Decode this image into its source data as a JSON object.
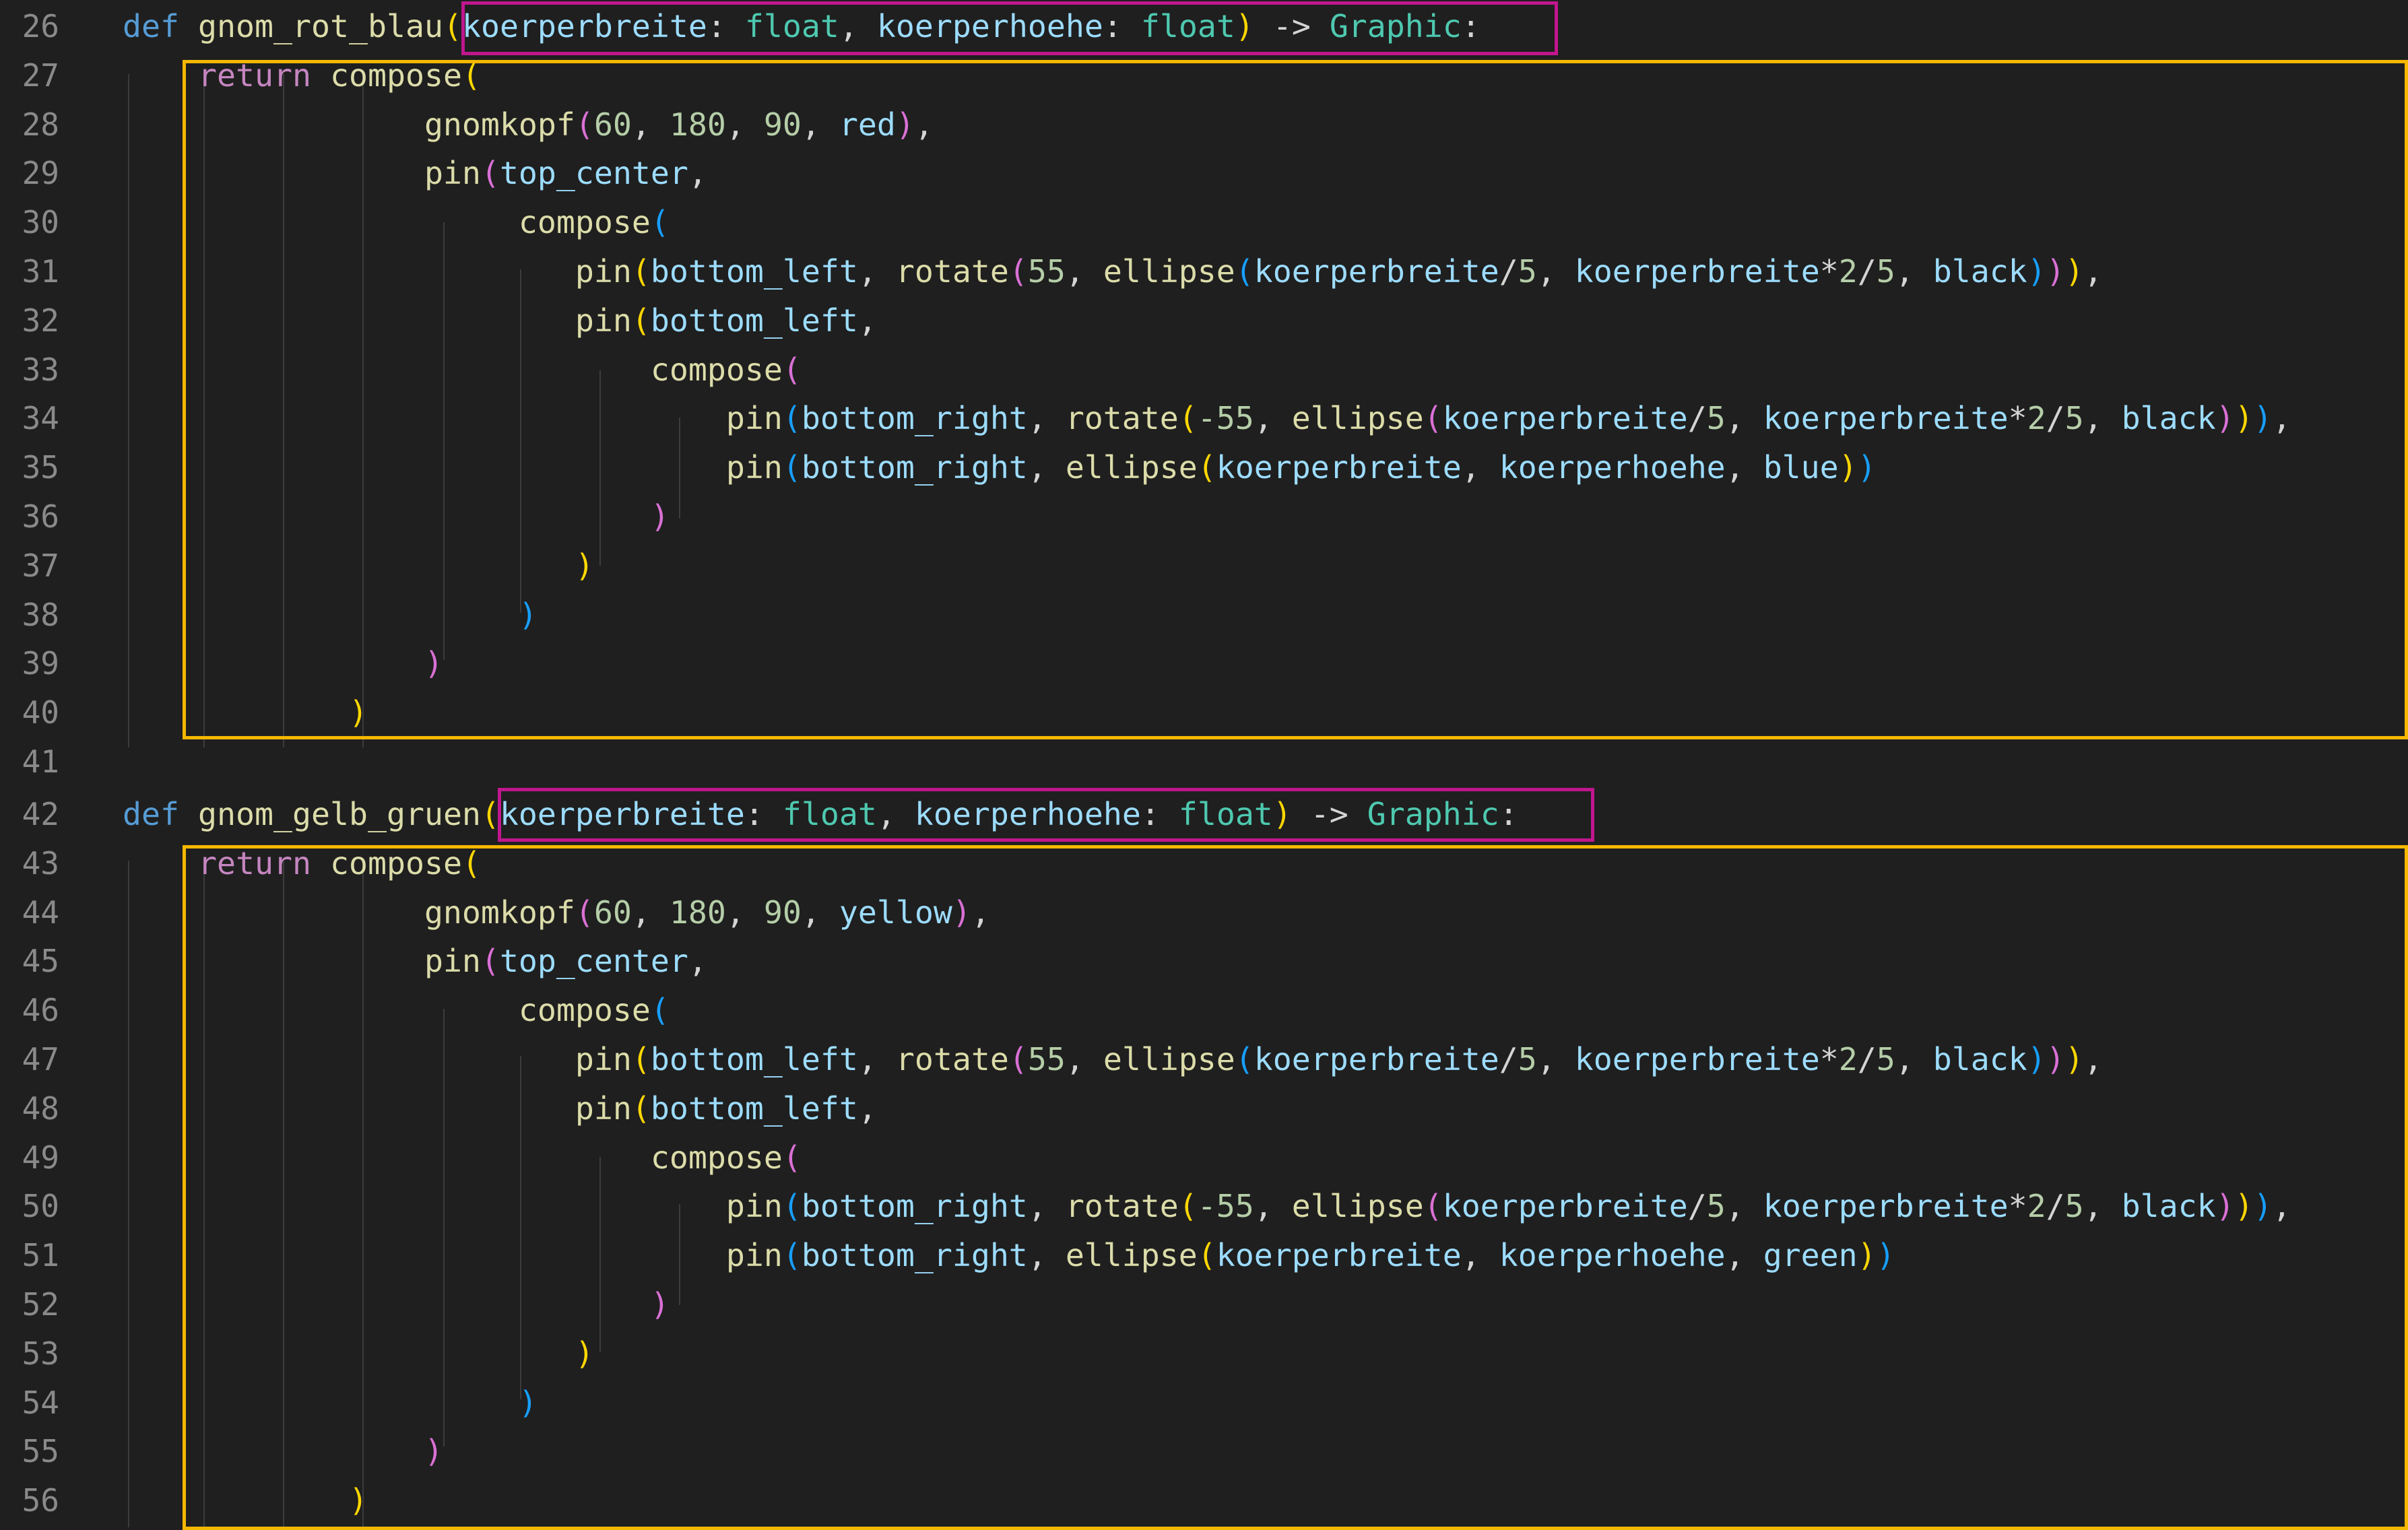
{
  "colors": {
    "background": "#1f1f1f",
    "signature_box": "#c0168e",
    "body_box": "#f5b800"
  },
  "lines": [
    {
      "num": "26",
      "tokens": [
        {
          "t": "def",
          "c": "kw"
        },
        {
          "t": " ",
          "c": "op"
        },
        {
          "t": "gnom_rot_blau",
          "c": "fn"
        },
        {
          "t": "(",
          "c": "b1"
        },
        {
          "t": "koerperbreite",
          "c": "param"
        },
        {
          "t": ": ",
          "c": "op"
        },
        {
          "t": "float",
          "c": "type"
        },
        {
          "t": ", ",
          "c": "op"
        },
        {
          "t": "koerperhoehe",
          "c": "param"
        },
        {
          "t": ": ",
          "c": "op"
        },
        {
          "t": "float",
          "c": "type"
        },
        {
          "t": ")",
          "c": "b1"
        },
        {
          "t": " -> ",
          "c": "op"
        },
        {
          "t": "Graphic",
          "c": "type"
        },
        {
          "t": ":",
          "c": "op"
        }
      ]
    },
    {
      "num": "27",
      "tokens": [
        {
          "t": "    ",
          "c": "op"
        },
        {
          "t": "return",
          "c": "ret"
        },
        {
          "t": " ",
          "c": "op"
        },
        {
          "t": "compose",
          "c": "fn"
        },
        {
          "t": "(",
          "c": "b1"
        }
      ]
    },
    {
      "num": "28",
      "tokens": [
        {
          "t": "                ",
          "c": "op"
        },
        {
          "t": "gnomkopf",
          "c": "fn"
        },
        {
          "t": "(",
          "c": "b2"
        },
        {
          "t": "60",
          "c": "num"
        },
        {
          "t": ", ",
          "c": "op"
        },
        {
          "t": "180",
          "c": "num"
        },
        {
          "t": ", ",
          "c": "op"
        },
        {
          "t": "90",
          "c": "num"
        },
        {
          "t": ", ",
          "c": "op"
        },
        {
          "t": "red",
          "c": "param"
        },
        {
          "t": ")",
          "c": "b2"
        },
        {
          "t": ",",
          "c": "op"
        }
      ]
    },
    {
      "num": "29",
      "tokens": [
        {
          "t": "                ",
          "c": "op"
        },
        {
          "t": "pin",
          "c": "fn"
        },
        {
          "t": "(",
          "c": "b2"
        },
        {
          "t": "top_center",
          "c": "param"
        },
        {
          "t": ",",
          "c": "op"
        }
      ]
    },
    {
      "num": "30",
      "tokens": [
        {
          "t": "                     ",
          "c": "op"
        },
        {
          "t": "compose",
          "c": "fn"
        },
        {
          "t": "(",
          "c": "b3"
        }
      ]
    },
    {
      "num": "31",
      "tokens": [
        {
          "t": "                        ",
          "c": "op"
        },
        {
          "t": "pin",
          "c": "fn"
        },
        {
          "t": "(",
          "c": "b1"
        },
        {
          "t": "bottom_left",
          "c": "param"
        },
        {
          "t": ", ",
          "c": "op"
        },
        {
          "t": "rotate",
          "c": "fn"
        },
        {
          "t": "(",
          "c": "b2"
        },
        {
          "t": "55",
          "c": "num"
        },
        {
          "t": ", ",
          "c": "op"
        },
        {
          "t": "ellipse",
          "c": "fn"
        },
        {
          "t": "(",
          "c": "b3"
        },
        {
          "t": "koerperbreite",
          "c": "param"
        },
        {
          "t": "/",
          "c": "op"
        },
        {
          "t": "5",
          "c": "num"
        },
        {
          "t": ", ",
          "c": "op"
        },
        {
          "t": "koerperbreite",
          "c": "param"
        },
        {
          "t": "*",
          "c": "op"
        },
        {
          "t": "2",
          "c": "num"
        },
        {
          "t": "/",
          "c": "op"
        },
        {
          "t": "5",
          "c": "num"
        },
        {
          "t": ", ",
          "c": "op"
        },
        {
          "t": "black",
          "c": "param"
        },
        {
          "t": ")",
          "c": "b3"
        },
        {
          "t": ")",
          "c": "b2"
        },
        {
          "t": ")",
          "c": "b1"
        },
        {
          "t": ",",
          "c": "op"
        }
      ]
    },
    {
      "num": "32",
      "tokens": [
        {
          "t": "                        ",
          "c": "op"
        },
        {
          "t": "pin",
          "c": "fn"
        },
        {
          "t": "(",
          "c": "b1"
        },
        {
          "t": "bottom_left",
          "c": "param"
        },
        {
          "t": ",",
          "c": "op"
        }
      ]
    },
    {
      "num": "33",
      "tokens": [
        {
          "t": "                            ",
          "c": "op"
        },
        {
          "t": "compose",
          "c": "fn"
        },
        {
          "t": "(",
          "c": "b2"
        }
      ]
    },
    {
      "num": "34",
      "tokens": [
        {
          "t": "                                ",
          "c": "op"
        },
        {
          "t": "pin",
          "c": "fn"
        },
        {
          "t": "(",
          "c": "b3"
        },
        {
          "t": "bottom_right",
          "c": "param"
        },
        {
          "t": ", ",
          "c": "op"
        },
        {
          "t": "rotate",
          "c": "fn"
        },
        {
          "t": "(",
          "c": "b1"
        },
        {
          "t": "-55",
          "c": "num"
        },
        {
          "t": ", ",
          "c": "op"
        },
        {
          "t": "ellipse",
          "c": "fn"
        },
        {
          "t": "(",
          "c": "b2"
        },
        {
          "t": "koerperbreite",
          "c": "param"
        },
        {
          "t": "/",
          "c": "op"
        },
        {
          "t": "5",
          "c": "num"
        },
        {
          "t": ", ",
          "c": "op"
        },
        {
          "t": "koerperbreite",
          "c": "param"
        },
        {
          "t": "*",
          "c": "op"
        },
        {
          "t": "2",
          "c": "num"
        },
        {
          "t": "/",
          "c": "op"
        },
        {
          "t": "5",
          "c": "num"
        },
        {
          "t": ", ",
          "c": "op"
        },
        {
          "t": "black",
          "c": "param"
        },
        {
          "t": ")",
          "c": "b2"
        },
        {
          "t": ")",
          "c": "b1"
        },
        {
          "t": ")",
          "c": "b3"
        },
        {
          "t": ",",
          "c": "op"
        }
      ]
    },
    {
      "num": "35",
      "tokens": [
        {
          "t": "                                ",
          "c": "op"
        },
        {
          "t": "pin",
          "c": "fn"
        },
        {
          "t": "(",
          "c": "b3"
        },
        {
          "t": "bottom_right",
          "c": "param"
        },
        {
          "t": ", ",
          "c": "op"
        },
        {
          "t": "ellipse",
          "c": "fn"
        },
        {
          "t": "(",
          "c": "b1"
        },
        {
          "t": "koerperbreite",
          "c": "param"
        },
        {
          "t": ", ",
          "c": "op"
        },
        {
          "t": "koerperhoehe",
          "c": "param"
        },
        {
          "t": ", ",
          "c": "op"
        },
        {
          "t": "blue",
          "c": "param"
        },
        {
          "t": ")",
          "c": "b1"
        },
        {
          "t": ")",
          "c": "b3"
        }
      ]
    },
    {
      "num": "36",
      "tokens": [
        {
          "t": "                            ",
          "c": "op"
        },
        {
          "t": ")",
          "c": "b2"
        }
      ]
    },
    {
      "num": "37",
      "tokens": [
        {
          "t": "                        ",
          "c": "op"
        },
        {
          "t": ")",
          "c": "b1"
        }
      ]
    },
    {
      "num": "38",
      "tokens": [
        {
          "t": "                     ",
          "c": "op"
        },
        {
          "t": ")",
          "c": "b3"
        }
      ]
    },
    {
      "num": "39",
      "tokens": [
        {
          "t": "                ",
          "c": "op"
        },
        {
          "t": ")",
          "c": "b2"
        }
      ]
    },
    {
      "num": "40",
      "tokens": [
        {
          "t": "            ",
          "c": "op"
        },
        {
          "t": ")",
          "c": "b1"
        }
      ]
    },
    {
      "num": "41",
      "tokens": []
    },
    {
      "num": "42",
      "tokens": [
        {
          "t": "def",
          "c": "kw"
        },
        {
          "t": " ",
          "c": "op"
        },
        {
          "t": "gnom_gelb_gruen",
          "c": "fn"
        },
        {
          "t": "(",
          "c": "b1"
        },
        {
          "t": "koerperbreite",
          "c": "param"
        },
        {
          "t": ": ",
          "c": "op"
        },
        {
          "t": "float",
          "c": "type"
        },
        {
          "t": ", ",
          "c": "op"
        },
        {
          "t": "koerperhoehe",
          "c": "param"
        },
        {
          "t": ": ",
          "c": "op"
        },
        {
          "t": "float",
          "c": "type"
        },
        {
          "t": ")",
          "c": "b1"
        },
        {
          "t": " -> ",
          "c": "op"
        },
        {
          "t": "Graphic",
          "c": "type"
        },
        {
          "t": ":",
          "c": "op"
        }
      ]
    },
    {
      "num": "43",
      "tokens": [
        {
          "t": "    ",
          "c": "op"
        },
        {
          "t": "return",
          "c": "ret"
        },
        {
          "t": " ",
          "c": "op"
        },
        {
          "t": "compose",
          "c": "fn"
        },
        {
          "t": "(",
          "c": "b1"
        }
      ]
    },
    {
      "num": "44",
      "tokens": [
        {
          "t": "                ",
          "c": "op"
        },
        {
          "t": "gnomkopf",
          "c": "fn"
        },
        {
          "t": "(",
          "c": "b2"
        },
        {
          "t": "60",
          "c": "num"
        },
        {
          "t": ", ",
          "c": "op"
        },
        {
          "t": "180",
          "c": "num"
        },
        {
          "t": ", ",
          "c": "op"
        },
        {
          "t": "90",
          "c": "num"
        },
        {
          "t": ", ",
          "c": "op"
        },
        {
          "t": "yellow",
          "c": "param"
        },
        {
          "t": ")",
          "c": "b2"
        },
        {
          "t": ",",
          "c": "op"
        }
      ]
    },
    {
      "num": "45",
      "tokens": [
        {
          "t": "                ",
          "c": "op"
        },
        {
          "t": "pin",
          "c": "fn"
        },
        {
          "t": "(",
          "c": "b2"
        },
        {
          "t": "top_center",
          "c": "param"
        },
        {
          "t": ",",
          "c": "op"
        }
      ]
    },
    {
      "num": "46",
      "tokens": [
        {
          "t": "                     ",
          "c": "op"
        },
        {
          "t": "compose",
          "c": "fn"
        },
        {
          "t": "(",
          "c": "b3"
        }
      ]
    },
    {
      "num": "47",
      "tokens": [
        {
          "t": "                        ",
          "c": "op"
        },
        {
          "t": "pin",
          "c": "fn"
        },
        {
          "t": "(",
          "c": "b1"
        },
        {
          "t": "bottom_left",
          "c": "param"
        },
        {
          "t": ", ",
          "c": "op"
        },
        {
          "t": "rotate",
          "c": "fn"
        },
        {
          "t": "(",
          "c": "b2"
        },
        {
          "t": "55",
          "c": "num"
        },
        {
          "t": ", ",
          "c": "op"
        },
        {
          "t": "ellipse",
          "c": "fn"
        },
        {
          "t": "(",
          "c": "b3"
        },
        {
          "t": "koerperbreite",
          "c": "param"
        },
        {
          "t": "/",
          "c": "op"
        },
        {
          "t": "5",
          "c": "num"
        },
        {
          "t": ", ",
          "c": "op"
        },
        {
          "t": "koerperbreite",
          "c": "param"
        },
        {
          "t": "*",
          "c": "op"
        },
        {
          "t": "2",
          "c": "num"
        },
        {
          "t": "/",
          "c": "op"
        },
        {
          "t": "5",
          "c": "num"
        },
        {
          "t": ", ",
          "c": "op"
        },
        {
          "t": "black",
          "c": "param"
        },
        {
          "t": ")",
          "c": "b3"
        },
        {
          "t": ")",
          "c": "b2"
        },
        {
          "t": ")",
          "c": "b1"
        },
        {
          "t": ",",
          "c": "op"
        }
      ]
    },
    {
      "num": "48",
      "tokens": [
        {
          "t": "                        ",
          "c": "op"
        },
        {
          "t": "pin",
          "c": "fn"
        },
        {
          "t": "(",
          "c": "b1"
        },
        {
          "t": "bottom_left",
          "c": "param"
        },
        {
          "t": ",",
          "c": "op"
        }
      ]
    },
    {
      "num": "49",
      "tokens": [
        {
          "t": "                            ",
          "c": "op"
        },
        {
          "t": "compose",
          "c": "fn"
        },
        {
          "t": "(",
          "c": "b2"
        }
      ]
    },
    {
      "num": "50",
      "tokens": [
        {
          "t": "                                ",
          "c": "op"
        },
        {
          "t": "pin",
          "c": "fn"
        },
        {
          "t": "(",
          "c": "b3"
        },
        {
          "t": "bottom_right",
          "c": "param"
        },
        {
          "t": ", ",
          "c": "op"
        },
        {
          "t": "rotate",
          "c": "fn"
        },
        {
          "t": "(",
          "c": "b1"
        },
        {
          "t": "-55",
          "c": "num"
        },
        {
          "t": ", ",
          "c": "op"
        },
        {
          "t": "ellipse",
          "c": "fn"
        },
        {
          "t": "(",
          "c": "b2"
        },
        {
          "t": "koerperbreite",
          "c": "param"
        },
        {
          "t": "/",
          "c": "op"
        },
        {
          "t": "5",
          "c": "num"
        },
        {
          "t": ", ",
          "c": "op"
        },
        {
          "t": "koerperbreite",
          "c": "param"
        },
        {
          "t": "*",
          "c": "op"
        },
        {
          "t": "2",
          "c": "num"
        },
        {
          "t": "/",
          "c": "op"
        },
        {
          "t": "5",
          "c": "num"
        },
        {
          "t": ", ",
          "c": "op"
        },
        {
          "t": "black",
          "c": "param"
        },
        {
          "t": ")",
          "c": "b2"
        },
        {
          "t": ")",
          "c": "b1"
        },
        {
          "t": ")",
          "c": "b3"
        },
        {
          "t": ",",
          "c": "op"
        }
      ]
    },
    {
      "num": "51",
      "tokens": [
        {
          "t": "                                ",
          "c": "op"
        },
        {
          "t": "pin",
          "c": "fn"
        },
        {
          "t": "(",
          "c": "b3"
        },
        {
          "t": "bottom_right",
          "c": "param"
        },
        {
          "t": ", ",
          "c": "op"
        },
        {
          "t": "ellipse",
          "c": "fn"
        },
        {
          "t": "(",
          "c": "b1"
        },
        {
          "t": "koerperbreite",
          "c": "param"
        },
        {
          "t": ", ",
          "c": "op"
        },
        {
          "t": "koerperhoehe",
          "c": "param"
        },
        {
          "t": ", ",
          "c": "op"
        },
        {
          "t": "green",
          "c": "param"
        },
        {
          "t": ")",
          "c": "b1"
        },
        {
          "t": ")",
          "c": "b3"
        }
      ]
    },
    {
      "num": "52",
      "tokens": [
        {
          "t": "                            ",
          "c": "op"
        },
        {
          "t": ")",
          "c": "b2"
        }
      ]
    },
    {
      "num": "53",
      "tokens": [
        {
          "t": "                        ",
          "c": "op"
        },
        {
          "t": ")",
          "c": "b1"
        }
      ]
    },
    {
      "num": "54",
      "tokens": [
        {
          "t": "                     ",
          "c": "op"
        },
        {
          "t": ")",
          "c": "b3"
        }
      ]
    },
    {
      "num": "55",
      "tokens": [
        {
          "t": "                ",
          "c": "op"
        },
        {
          "t": ")",
          "c": "b2"
        }
      ]
    },
    {
      "num": "56",
      "tokens": [
        {
          "t": "            ",
          "c": "op"
        },
        {
          "t": ")",
          "c": "b1"
        }
      ]
    }
  ]
}
